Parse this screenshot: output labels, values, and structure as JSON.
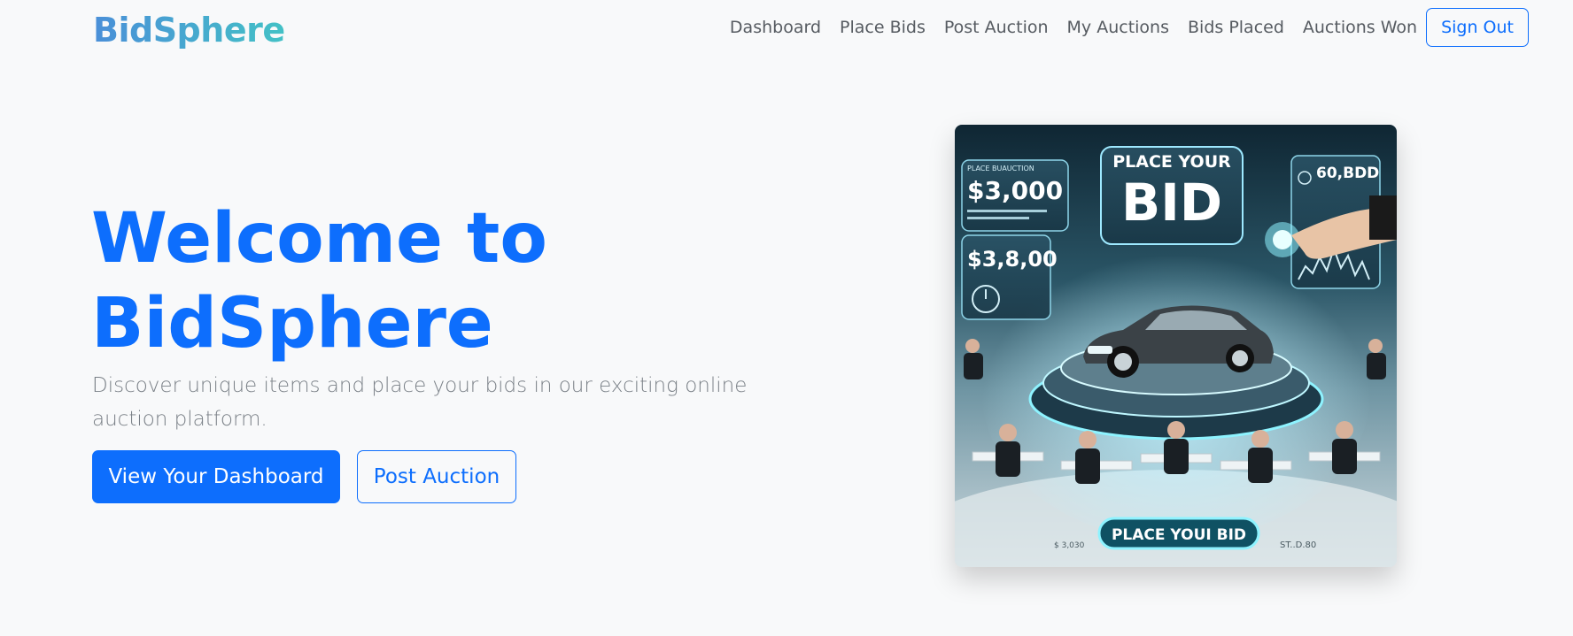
{
  "navbar": {
    "brand": "BidSphere",
    "links": [
      "Dashboard",
      "Place Bids",
      "Post Auction",
      "My Auctions",
      "Bids Placed",
      "Auctions Won"
    ],
    "sign_out": "Sign Out"
  },
  "hero": {
    "title_line1": "Welcome to",
    "title_line2": "BidSphere",
    "subtitle": "Discover unique items and place your bids in our exciting online auction platform.",
    "primary_button": "View Your Dashboard",
    "secondary_button": "Post Auction"
  },
  "image": {
    "panel_place_your": "PLACE YOUR",
    "panel_bid": "BID",
    "left_panel_caption": "PLACE BUAUCTION",
    "left_amount_1": "$3,000",
    "left_amount_2": "$3,8,00",
    "right_amount": "60,BDD",
    "bottom_button": "PLACE YOUI BID",
    "bottom_left_text": "$ 3,030",
    "bottom_right_text": "ST..D.80"
  }
}
